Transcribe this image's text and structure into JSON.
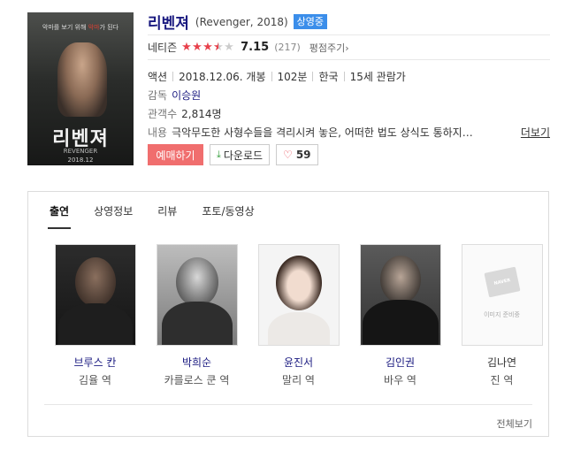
{
  "poster": {
    "tagline_pre": "악마를 보기 위해",
    "tagline_highlight": "악마",
    "tagline_post": "가 된다",
    "title": "리벤져",
    "subtitle": "REVENGER",
    "date": "2018.12"
  },
  "movie": {
    "title": "리벤져",
    "original_title": "(Revenger, 2018)",
    "status_badge": "상영중",
    "rating_label": "네티즌",
    "rating_stars": 3.5,
    "rating_score": "7.15",
    "rating_count": "(217)",
    "review_link": "평점주기",
    "genre": "액션",
    "release": "2018.12.06. 개봉",
    "runtime": "102분",
    "country": "한국",
    "age_rating": "15세 관람가",
    "director_key": "감독",
    "director": "이승원",
    "audience_key": "관객수",
    "audience": "2,814명",
    "desc_key": "내용",
    "desc": "극악무도한 사형수들을 격리시켜 놓은, 어떠한 법도 상식도 통하지…",
    "more_link": "더보기",
    "book_button": "예매하기",
    "download_button": "다운로드",
    "like_count": "59"
  },
  "tabs": [
    {
      "label": "출연",
      "active": true
    },
    {
      "label": "상영정보",
      "active": false
    },
    {
      "label": "리뷰",
      "active": false
    },
    {
      "label": "포토/동영상",
      "active": false
    }
  ],
  "cast": [
    {
      "name": "브루스 칸",
      "role": "김율 역"
    },
    {
      "name": "박희순",
      "role": "카를로스 쿤 역"
    },
    {
      "name": "윤진서",
      "role": "말리 역"
    },
    {
      "name": "김인권",
      "role": "바우 역"
    },
    {
      "name": "김나연",
      "role": "진 역"
    }
  ],
  "placeholder": {
    "brand": "NAVER",
    "label": "이미지 준비중"
  },
  "view_all": "전체보기",
  "colors": {
    "accent_title": "#1a1a80",
    "badge": "#3b8eea",
    "book": "#f06e6e",
    "star": "#e8414c"
  }
}
